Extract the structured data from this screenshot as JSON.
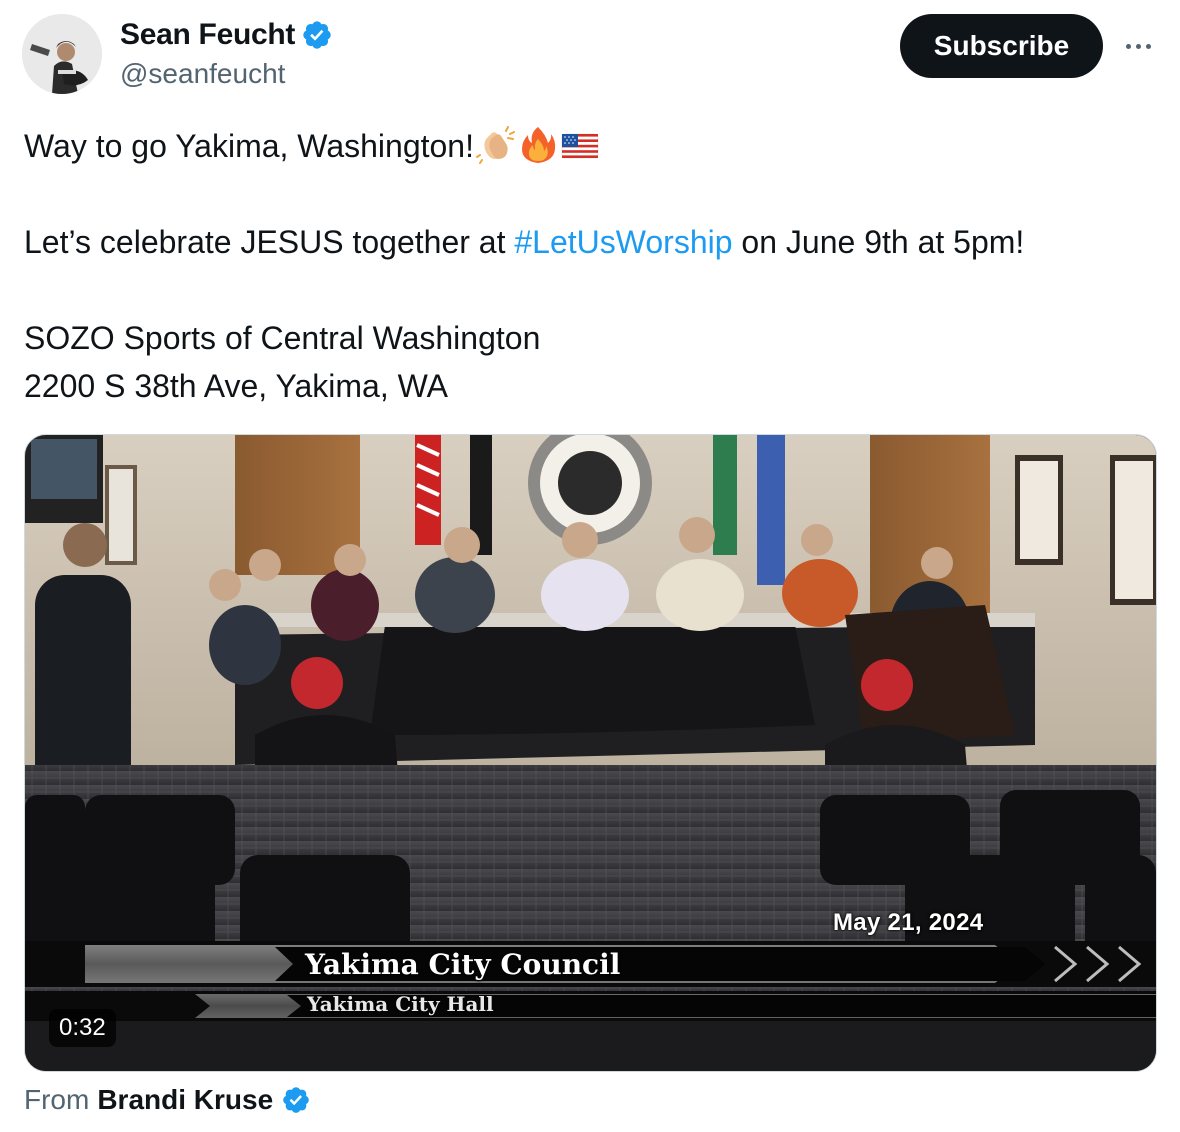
{
  "author": {
    "name": "Sean Feucht",
    "handle": "@seanfeucht",
    "verified_color": "#1d9bf0"
  },
  "actions": {
    "subscribe_label": "Subscribe",
    "more_icon": "more-horizontal-icon"
  },
  "tweet": {
    "line1_text": "Way to go Yakima, Washington!",
    "line1_emojis": [
      "clapping-hands-emoji",
      "fire-emoji",
      "us-flag-emoji"
    ],
    "line2_before": "Let’s celebrate JESUS together at ",
    "line2_hashtag": "#LetUsWorship",
    "line2_after": " on June 9th at 5pm!",
    "line3": "SOZO Sports of Central Washington",
    "line4": "2200 S 38th Ave, Yakima, WA"
  },
  "media": {
    "date": "May 21, 2024",
    "banner_title": "Yakima City Council",
    "banner_subtitle": "Yakima City Hall",
    "duration": "0:32"
  },
  "attribution": {
    "prefix": "From",
    "name": "Brandi Kruse"
  },
  "colors": {
    "text": "#0f1419",
    "secondary": "#536471",
    "link": "#1d9bf0",
    "button_bg": "#0f1419"
  }
}
